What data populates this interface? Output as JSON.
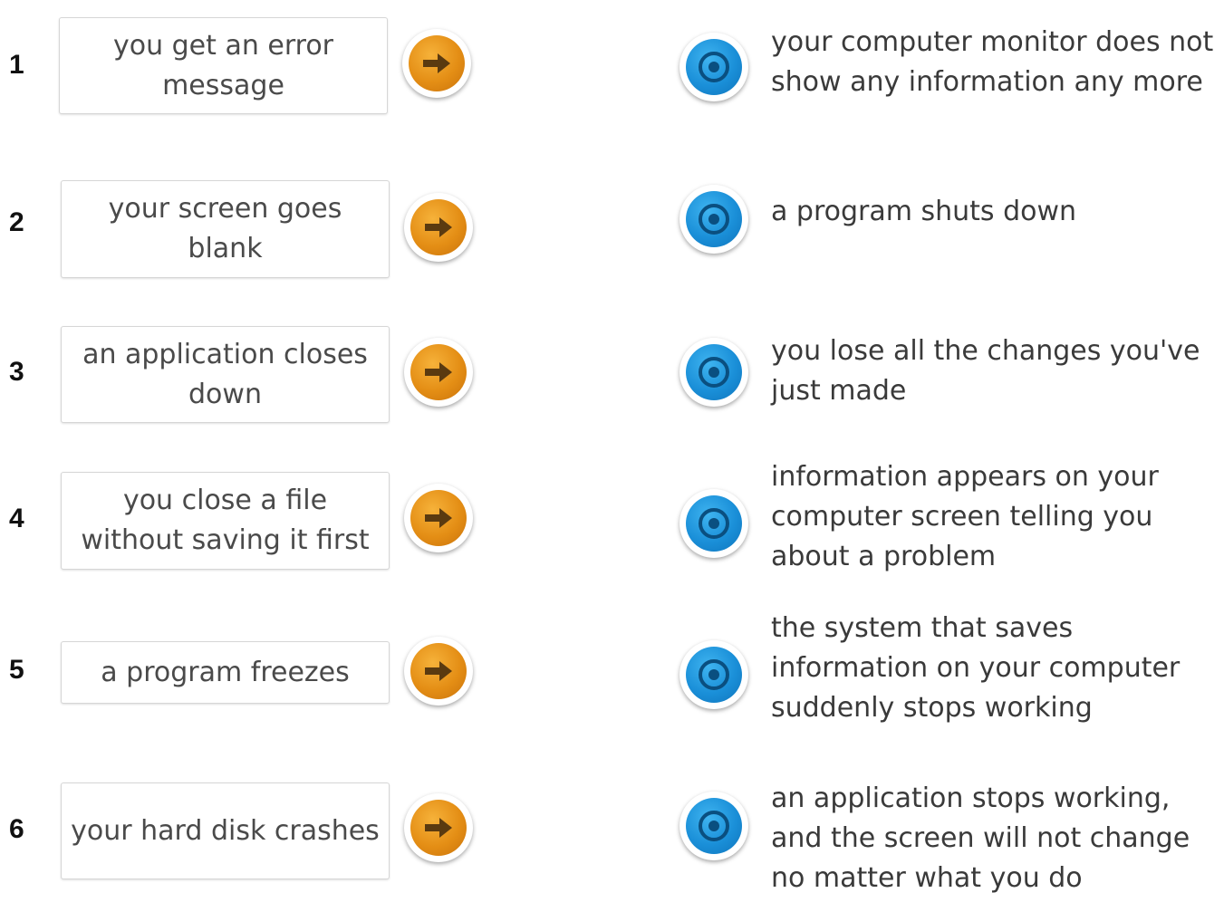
{
  "colors": {
    "drag_button": "#e48e15",
    "drop_button": "#1a8fd8",
    "box_border": "#d6d6d6",
    "text": "#3d3d3d"
  },
  "icons": {
    "drag": "arrow-right-icon",
    "drop": "target-icon"
  },
  "rows": [
    {
      "number": "1",
      "prompt": "you get an error message",
      "answer": "your computer monitor does not show any information any more"
    },
    {
      "number": "2",
      "prompt": "your screen goes blank",
      "answer": "a program shuts down"
    },
    {
      "number": "3",
      "prompt": "an application closes down",
      "answer": "you lose all the changes you've just made"
    },
    {
      "number": "4",
      "prompt": "you close a file without saving it first",
      "answer": "information appears on your computer screen telling you about a problem"
    },
    {
      "number": "5",
      "prompt": "a program freezes",
      "answer": "the system that saves information on your computer suddenly stops working"
    },
    {
      "number": "6",
      "prompt": "your hard disk crashes",
      "answer": "an application stops working, and the screen will not change no matter what you do"
    }
  ]
}
